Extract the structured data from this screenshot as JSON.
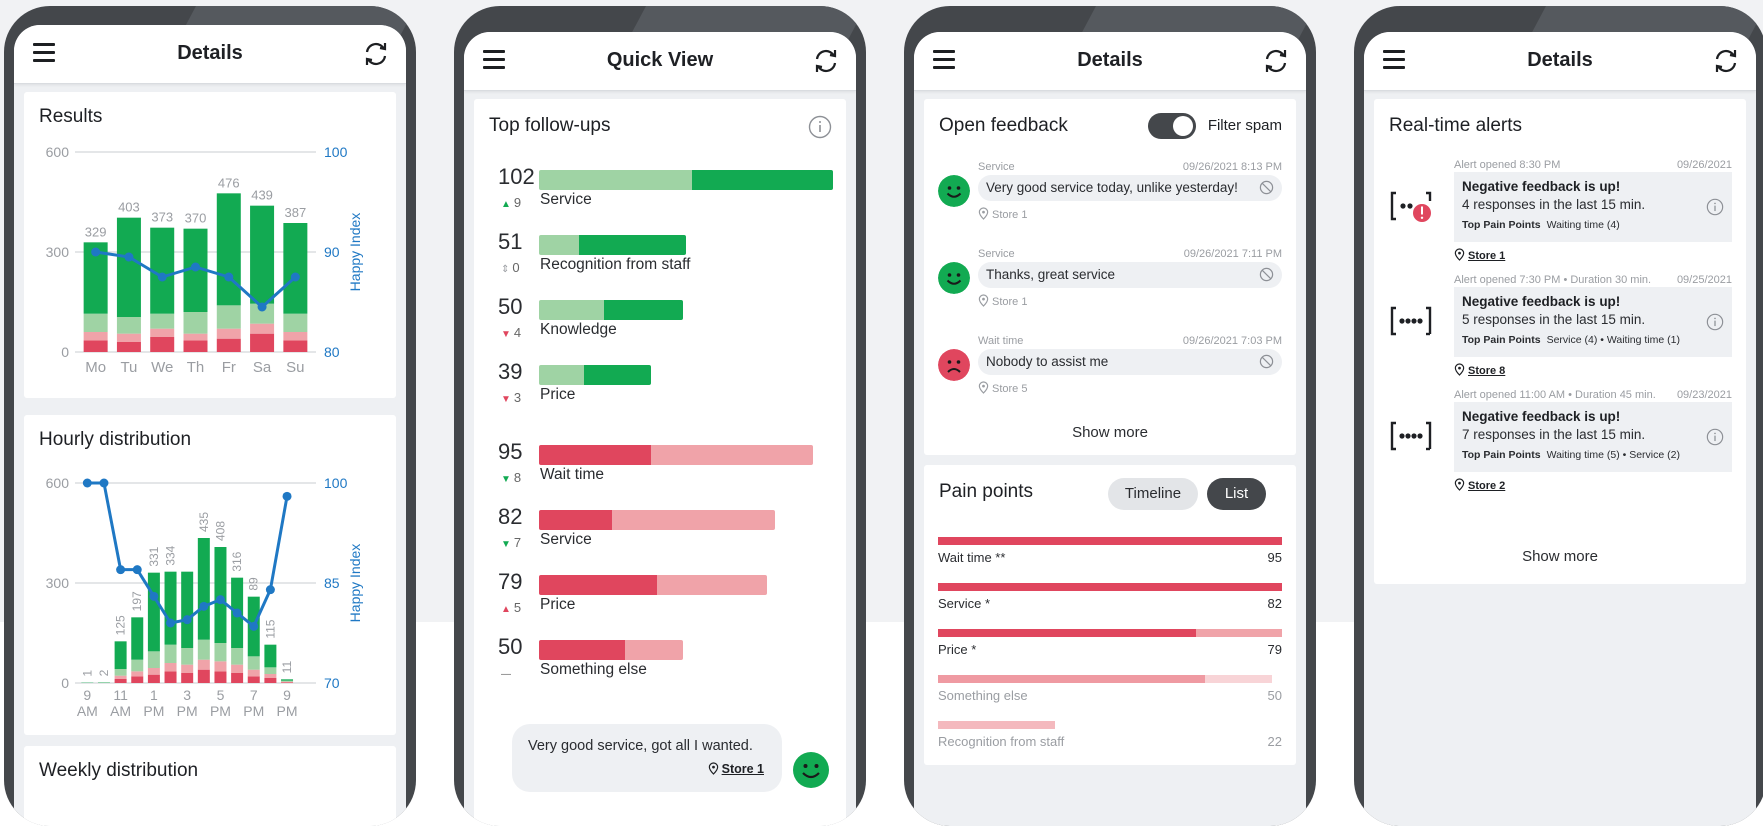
{
  "phones": {
    "results": {
      "title": "Details",
      "results_title": "Results",
      "hourly_title": "Hourly distribution",
      "weekly_title": "Weekly distribution",
      "happy_index_label": "Happy Index"
    },
    "quick": {
      "title": "Quick View",
      "card_title": "Top follow-ups",
      "items": [
        {
          "value": "102",
          "change": "9",
          "dir": "up",
          "label": "Service",
          "kind": "pos"
        },
        {
          "value": "51",
          "change": "0",
          "dir": "flat",
          "label": "Recognition from staff",
          "kind": "pos"
        },
        {
          "value": "50",
          "change": "4",
          "dir": "down",
          "label": "Knowledge",
          "kind": "pos"
        },
        {
          "value": "39",
          "change": "3",
          "dir": "down",
          "label": "Price",
          "kind": "pos"
        },
        {
          "value": "95",
          "change": "8",
          "dir": "down",
          "label": "Wait time",
          "kind": "neg"
        },
        {
          "value": "82",
          "change": "7",
          "dir": "down",
          "label": "Service",
          "kind": "neg"
        },
        {
          "value": "79",
          "change": "5",
          "dir": "up",
          "label": "Price",
          "kind": "neg"
        },
        {
          "value": "50",
          "change": "",
          "dir": "none",
          "label": "Something else",
          "kind": "neg"
        }
      ],
      "comment": {
        "text": "Very good service, got all I wanted.",
        "store": "Store 1"
      }
    },
    "feedback": {
      "title": "Details",
      "card_title": "Open feedback",
      "filter_label": "Filter spam",
      "items": [
        {
          "category": "Service",
          "datetime": "09/26/2021 8:13 PM",
          "text": "Very good service today, unlike yesterday!",
          "store": "Store 1",
          "mood": "happy"
        },
        {
          "category": "Service",
          "datetime": "09/26/2021 7:11 PM",
          "text": "Thanks, great service",
          "store": "Store 1",
          "mood": "happy"
        },
        {
          "category": "Wait time",
          "datetime": "09/26/2021 7:03 PM",
          "text": "Nobody to assist me",
          "store": "Store 5",
          "mood": "sad"
        }
      ],
      "show_more": "Show more",
      "pain_title": "Pain points",
      "timeline_label": "Timeline",
      "list_label": "List",
      "pain_items": [
        {
          "label": "Wait time **",
          "value": "95",
          "strong": 1.0,
          "light": 0.0
        },
        {
          "label": "Service *",
          "value": "82",
          "strong": 1.0,
          "light": 0.0
        },
        {
          "label": "Price *",
          "value": "79",
          "strong": 0.75,
          "light": 0.25
        },
        {
          "label": "Something else",
          "value": "50",
          "strong": 0.0,
          "light": 0.97
        },
        {
          "label": "Recognition from staff",
          "value": "22",
          "strong": 0.0,
          "light": 0.34
        }
      ]
    },
    "alerts": {
      "title": "Details",
      "card_title": "Real-time alerts",
      "items": [
        {
          "opened": "Alert opened 8:30 PM",
          "date": "09/26/2021",
          "headline": "Negative feedback is up!",
          "detail": "4 responses in the last 15 min.",
          "pain_label": "Top Pain Points",
          "pain": "Waiting time (4)",
          "store": "Store 1",
          "urgent": true
        },
        {
          "opened": "Alert opened 7:30 PM • Duration 30 min.",
          "date": "09/25/2021",
          "headline": "Negative feedback is up!",
          "detail": "5 responses in the last 15 min.",
          "pain_label": "Top Pain Points",
          "pain": "Service (4) • Waiting time (1)",
          "store": "Store 8",
          "urgent": false
        },
        {
          "opened": "Alert opened 11:00 AM • Duration 45 min.",
          "date": "09/23/2021",
          "headline": "Negative feedback is up!",
          "detail": "7 responses in the last 15 min.",
          "pain_label": "Top Pain Points",
          "pain": "Waiting time (5) • Service (2)",
          "store": "Store 2",
          "urgent": false
        }
      ],
      "show_more": "Show more"
    }
  },
  "chart_data": [
    {
      "type": "bar",
      "title": "Results",
      "categories": [
        "Mo",
        "Tu",
        "We",
        "Th",
        "Fr",
        "Sa",
        "Su"
      ],
      "totals": [
        329,
        403,
        373,
        370,
        476,
        439,
        387
      ],
      "series": [
        {
          "name": "",
          "color": "#e0465e",
          "values": [
            35,
            30,
            45,
            35,
            40,
            55,
            35
          ]
        },
        {
          "name": "",
          "color": "#f0a3a9",
          "values": [
            25,
            25,
            25,
            20,
            30,
            30,
            25
          ]
        },
        {
          "name": "",
          "color": "#9fd3a4",
          "values": [
            55,
            50,
            45,
            65,
            70,
            60,
            55
          ]
        },
        {
          "name": "",
          "color": "#12aa52",
          "values": [
            214,
            298,
            258,
            250,
            336,
            294,
            272
          ]
        }
      ],
      "line": {
        "name": "Happy Index",
        "color": "#1f78c4",
        "values": [
          90,
          89.5,
          87.5,
          88.5,
          87.5,
          84.5,
          87.5
        ]
      },
      "ylim": [
        0,
        600
      ],
      "y2lim": [
        80,
        100
      ],
      "yticks": [
        0,
        300,
        600
      ],
      "y2ticks": [
        80,
        90,
        100
      ],
      "y2label": "Happy Index"
    },
    {
      "type": "bar",
      "title": "Hourly distribution",
      "categories": [
        "9",
        "10",
        "11",
        "12",
        "1",
        "2",
        "3",
        "4",
        "5",
        "6",
        "7",
        "8",
        "9",
        "10"
      ],
      "x_tick_labels": [
        "9\nAM",
        "11\nAM",
        "1\nPM",
        "3\nPM",
        "5\nPM",
        "7\nPM",
        "9\nPM"
      ],
      "totals": [
        1,
        2,
        125,
        197,
        331,
        334,
        334,
        435,
        408,
        316,
        259,
        115,
        11,
        null
      ],
      "total_labels": [
        "1",
        "2",
        "125",
        "197",
        "331",
        "334",
        "",
        "435",
        "408",
        "316",
        "89",
        "115",
        "11",
        ""
      ],
      "series": [
        {
          "name": "",
          "color": "#e0465e",
          "values": [
            0,
            0,
            12,
            20,
            25,
            35,
            30,
            40,
            35,
            30,
            20,
            15,
            2,
            0
          ]
        },
        {
          "name": "",
          "color": "#f0a3a9",
          "values": [
            0,
            0,
            10,
            15,
            20,
            25,
            25,
            30,
            30,
            25,
            20,
            12,
            2,
            0
          ]
        },
        {
          "name": "",
          "color": "#9fd3a4",
          "values": [
            0,
            1,
            20,
            35,
            50,
            55,
            50,
            60,
            55,
            50,
            40,
            20,
            3,
            0
          ]
        },
        {
          "name": "",
          "color": "#12aa52",
          "values": [
            1,
            1,
            83,
            127,
            236,
            219,
            229,
            305,
            288,
            211,
            179,
            68,
            4,
            0
          ]
        }
      ],
      "line": {
        "name": "Happy Index",
        "color": "#1f78c4",
        "values": [
          100,
          100,
          87,
          87,
          83,
          79,
          79.5,
          81.5,
          82.5,
          80.5,
          78.5,
          84,
          98,
          null
        ]
      },
      "ylim": [
        0,
        600
      ],
      "y2lim": [
        70,
        100
      ],
      "yticks": [
        0,
        300,
        600
      ],
      "y2ticks": [
        70,
        85,
        100
      ],
      "y2label": "Happy Index"
    }
  ],
  "colors": {
    "green": "#12aa52",
    "light_green": "#9fd3a4",
    "red": "#e0465e",
    "light_red": "#f0a3a9",
    "blue": "#1f78c4",
    "dark": "#44474b"
  }
}
